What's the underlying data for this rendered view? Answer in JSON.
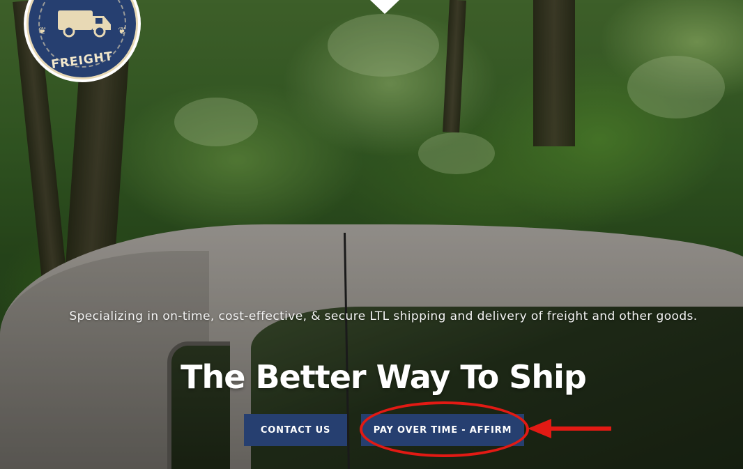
{
  "logo": {
    "text": "FREIGHT"
  },
  "hero": {
    "tagline": "Specializing in on-time, cost-effective, & secure LTL shipping and delivery of freight and other goods.",
    "headline": "The Better Way To Ship"
  },
  "buttons": {
    "contact_label": "CONTACT US",
    "affirm_label": "PAY OVER TIME - AFFIRM"
  },
  "colors": {
    "brand_navy": "#263f70",
    "annotation_red": "#e21a14",
    "logo_cream": "#e8d9b5"
  },
  "icons": {
    "logo_icon": "delivery-truck-icon",
    "annotation_arrow": "left-arrow-icon"
  }
}
